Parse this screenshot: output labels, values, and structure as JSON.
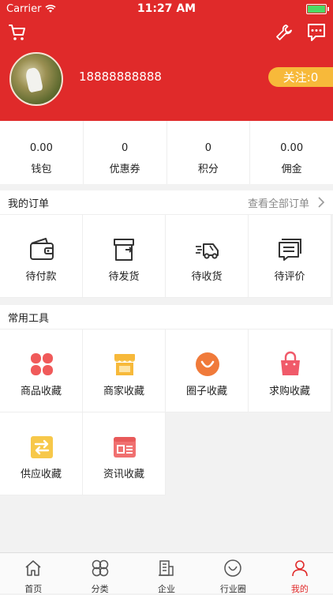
{
  "status_bar": {
    "carrier": "Carrier",
    "time": "11:27 AM"
  },
  "header": {
    "phone": "18888888888",
    "follow_label": "关注:0",
    "brand_color": "#e02a2a"
  },
  "stats": [
    {
      "value": "0.00",
      "label": "钱包"
    },
    {
      "value": "0",
      "label": "优惠券"
    },
    {
      "value": "0",
      "label": "积分"
    },
    {
      "value": "0.00",
      "label": "佣金"
    }
  ],
  "orders": {
    "title": "我的订单",
    "more_label": "查看全部订单",
    "items": [
      {
        "label": "待付款",
        "icon": "wallet-icon"
      },
      {
        "label": "待发货",
        "icon": "box-icon"
      },
      {
        "label": "待收货",
        "icon": "truck-icon"
      },
      {
        "label": "待评价",
        "icon": "comment-icon"
      }
    ]
  },
  "tools": {
    "title": "常用工具",
    "items": [
      {
        "label": "商品收藏",
        "icon": "clover-icon",
        "color": "#f05a5a"
      },
      {
        "label": "商家收藏",
        "icon": "shop-icon",
        "color": "#f7b93a"
      },
      {
        "label": "圈子收藏",
        "icon": "smile-icon",
        "color": "#f07a3a"
      },
      {
        "label": "求购收藏",
        "icon": "bag-icon",
        "color": "#f05a6a"
      },
      {
        "label": "供应收藏",
        "icon": "exchange-icon",
        "color": "#f7c84a"
      },
      {
        "label": "资讯收藏",
        "icon": "news-icon",
        "color": "#f07070"
      }
    ]
  },
  "tabbar": {
    "items": [
      {
        "label": "首页",
        "icon": "home-icon"
      },
      {
        "label": "分类",
        "icon": "category-icon"
      },
      {
        "label": "企业",
        "icon": "building-icon"
      },
      {
        "label": "行业圈",
        "icon": "circle-icon"
      },
      {
        "label": "我的",
        "icon": "user-icon"
      }
    ],
    "active_color": "#e02a2a"
  }
}
